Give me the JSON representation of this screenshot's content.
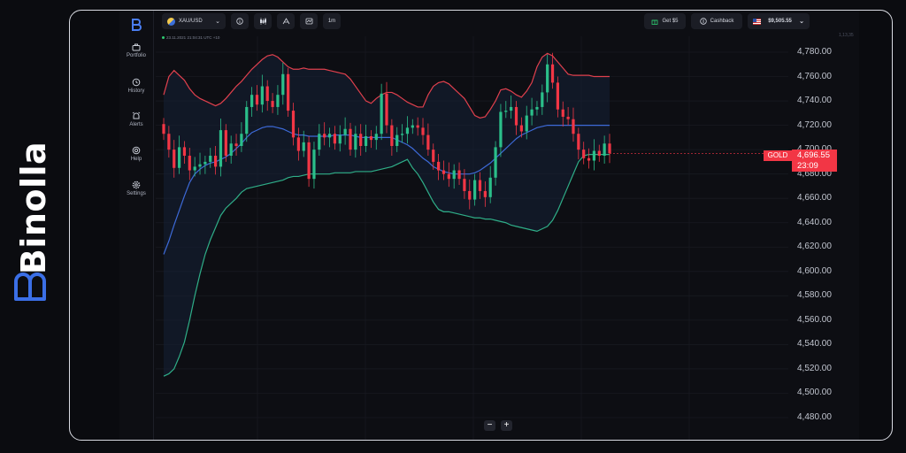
{
  "brand": {
    "name": "Binolla"
  },
  "sidebar": {
    "items": [
      {
        "label": "Portfolio",
        "icon": "briefcase-icon"
      },
      {
        "label": "History",
        "icon": "history-icon"
      },
      {
        "label": "Alerts",
        "icon": "alarm-icon"
      },
      {
        "label": "Help",
        "icon": "lifebuoy-icon"
      },
      {
        "label": "Settings",
        "icon": "gear-icon"
      }
    ]
  },
  "toolbar": {
    "asset": "XAU/USD",
    "timeframe": "1m",
    "get_bonus": "Get $5",
    "cashback": "Cashback",
    "balance": "$9,505.55"
  },
  "chart_info": {
    "text": "23.11.2021  21:04:31  UTC +10"
  },
  "price_tag": {
    "symbol": "GOLD",
    "price": "4,696.55",
    "timer": "23:09"
  },
  "axis_top_label": "1,13,35",
  "colors": {
    "up": "#2bbf8a",
    "down": "#f23645",
    "upper_band": "#e0404d",
    "middle_band": "#3d6ad8",
    "lower_band": "#2fae88",
    "accent": "#f23645"
  },
  "chart_data": {
    "type": "candlestick",
    "indicator": "Bollinger Bands",
    "ylim": [
      4470,
      4790
    ],
    "y_ticks": [
      "4,780.00",
      "4,760.00",
      "4,740.00",
      "4,720.00",
      "4,700.00",
      "4,680.00",
      "4,660.00",
      "4,640.00",
      "4,620.00",
      "4,600.00",
      "4,580.00",
      "4,560.00",
      "4,540.00",
      "4,520.00",
      "4,500.00",
      "4,480.00"
    ],
    "y_tick_values": [
      4780,
      4760,
      4740,
      4720,
      4700,
      4680,
      4660,
      4640,
      4620,
      4600,
      4580,
      4560,
      4540,
      4520,
      4500,
      4480
    ],
    "closes": [
      4713,
      4700,
      4685,
      4702,
      4695,
      4683,
      4686,
      4688,
      4690,
      4695,
      4686,
      4716,
      4695,
      4705,
      4703,
      4713,
      4735,
      4745,
      4737,
      4752,
      4740,
      4735,
      4745,
      4762,
      4732,
      4710,
      4699,
      4706,
      4676,
      4700,
      4713,
      4710,
      4713,
      4705,
      4712,
      4717,
      4700,
      4713,
      4703,
      4711,
      4708,
      4713,
      4746,
      4720,
      4703,
      4712,
      4713,
      4718,
      4720,
      4718,
      4712,
      4700,
      4690,
      4683,
      4680,
      4676,
      4683,
      4676,
      4666,
      4659,
      4675,
      4666,
      4661,
      4677,
      4702,
      4731,
      4732,
      4735,
      4720,
      4715,
      4728,
      4733,
      4735,
      4747,
      4770,
      4755,
      4733,
      4727,
      4725,
      4713,
      4700,
      4693,
      4691,
      4699,
      4695,
      4705,
      4697
    ],
    "upper_band": [
      4745,
      4760,
      4765,
      4761,
      4757,
      4750,
      4745,
      4742,
      4740,
      4738,
      4736,
      4738,
      4742,
      4747,
      4752,
      4756,
      4761,
      4766,
      4770,
      4774,
      4777,
      4778,
      4776,
      4772,
      4768,
      4766,
      4766,
      4767,
      4766,
      4766,
      4766,
      4766,
      4765,
      4764,
      4763,
      4762,
      4758,
      4752,
      4746,
      4740,
      4738,
      4742,
      4745,
      4747,
      4747,
      4745,
      4742,
      4739,
      4737,
      4735,
      4735,
      4745,
      4752,
      4755,
      4756,
      4754,
      4750,
      4746,
      4742,
      4735,
      4728,
      4726,
      4727,
      4733,
      4740,
      4749,
      4750,
      4748,
      4745,
      4743,
      4748,
      4755,
      4768,
      4776,
      4779,
      4777,
      4772,
      4767,
      4762,
      4761,
      4761,
      4761,
      4761,
      4760,
      4760,
      4760,
      4760
    ],
    "middle_band": [
      4614,
      4625,
      4638,
      4650,
      4662,
      4673,
      4680,
      4684,
      4687,
      4689,
      4690,
      4692,
      4694,
      4697,
      4701,
      4705,
      4710,
      4714,
      4716,
      4718,
      4719,
      4719,
      4718,
      4717,
      4715,
      4713,
      4712,
      4712,
      4711,
      4711,
      4711,
      4711,
      4711,
      4712,
      4712,
      4712,
      4712,
      4711,
      4710,
      4710,
      4710,
      4710,
      4710,
      4710,
      4710,
      4708,
      4706,
      4704,
      4701,
      4697,
      4693,
      4690,
      4686,
      4684,
      4682,
      4681,
      4680,
      4680,
      4680,
      4680,
      4681,
      4683,
      4686,
      4689,
      4693,
      4697,
      4701,
      4705,
      4709,
      4712,
      4714,
      4716,
      4718,
      4719,
      4720,
      4720,
      4720,
      4720,
      4720,
      4720,
      4720,
      4720,
      4720,
      4720,
      4720,
      4720,
      4720
    ],
    "lower_band": [
      4514,
      4516,
      4520,
      4530,
      4542,
      4560,
      4580,
      4598,
      4614,
      4626,
      4636,
      4646,
      4652,
      4656,
      4660,
      4665,
      4668,
      4669,
      4670,
      4671,
      4672,
      4673,
      4674,
      4675,
      4677,
      4678,
      4678,
      4679,
      4680,
      4680,
      4680,
      4680,
      4680,
      4681,
      4681,
      4681,
      4681,
      4682,
      4682,
      4682,
      4682,
      4683,
      4684,
      4685,
      4686,
      4688,
      4690,
      4692,
      4685,
      4680,
      4673,
      4665,
      4657,
      4651,
      4649,
      4649,
      4648,
      4647,
      4646,
      4645,
      4644,
      4644,
      4643,
      4643,
      4642,
      4641,
      4640,
      4638,
      4637,
      4636,
      4635,
      4634,
      4633,
      4635,
      4637,
      4642,
      4650,
      4660,
      4670,
      4680,
      4690,
      4695,
      4696,
      4696,
      4696,
      4696,
      4696
    ]
  }
}
